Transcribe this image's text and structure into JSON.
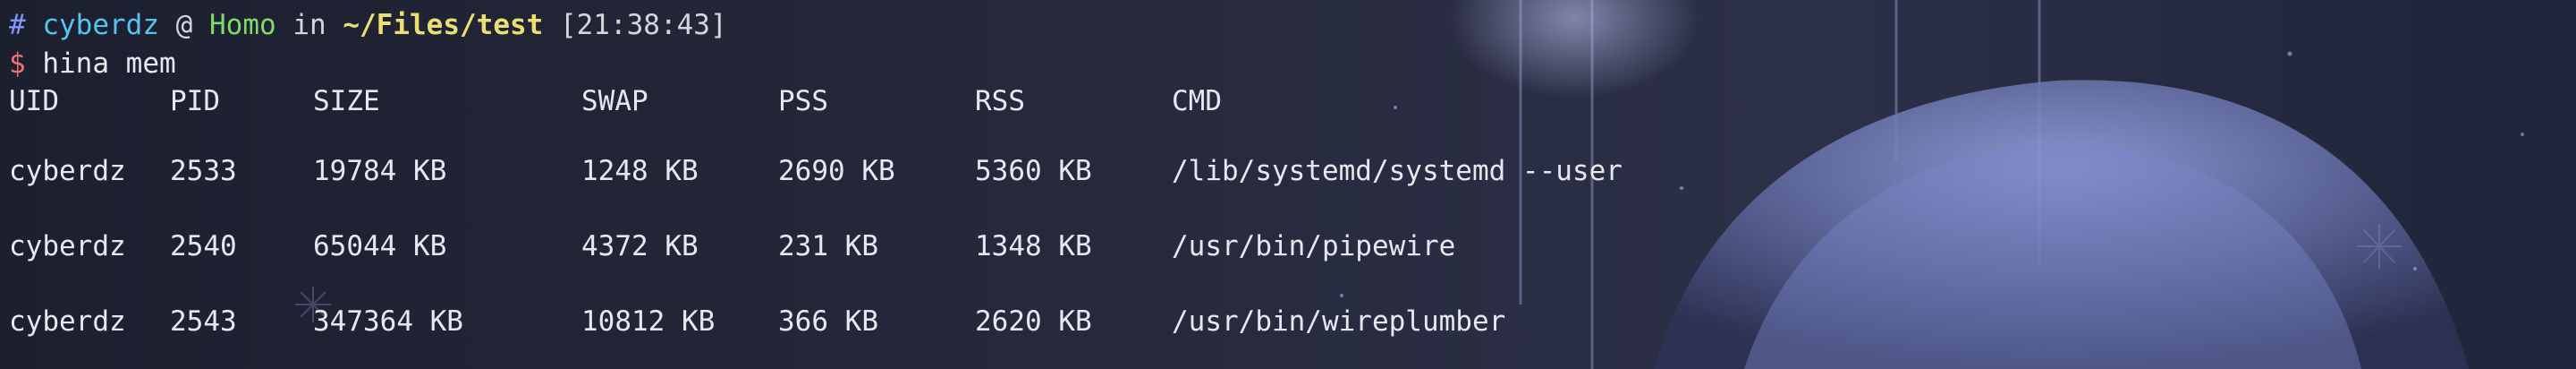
{
  "prompt": {
    "hash": "#",
    "user": "cyberdz",
    "at": "@",
    "host": "Homo",
    "in_word": "in",
    "path": "~/Files/test",
    "time": "[21:38:43]"
  },
  "command": {
    "dollar": "$",
    "text": "hina mem"
  },
  "table": {
    "headers": [
      "UID",
      "PID",
      "SIZE",
      "SWAP",
      "PSS",
      "RSS",
      "CMD"
    ],
    "rows": [
      [
        "cyberdz",
        "2533",
        "19784 KB",
        "1248 KB",
        "2690 KB",
        "5360 KB",
        "/lib/systemd/systemd --user"
      ],
      [
        "cyberdz",
        "2540",
        "65044 KB",
        "4372 KB",
        "231 KB",
        "1348 KB",
        "/usr/bin/pipewire"
      ],
      [
        "cyberdz",
        "2543",
        "347364 KB",
        "10812 KB",
        "366 KB",
        "2620 KB",
        "/usr/bin/wireplumber"
      ]
    ]
  },
  "theme": {
    "background": "#232637",
    "hash_color": "#7f97ff",
    "user_color": "#57c4f0",
    "host_color": "#7fdc6a",
    "path_color": "#ecdf72",
    "dollar_color": "#ef6f79",
    "text_color": "#e6e8ef"
  }
}
